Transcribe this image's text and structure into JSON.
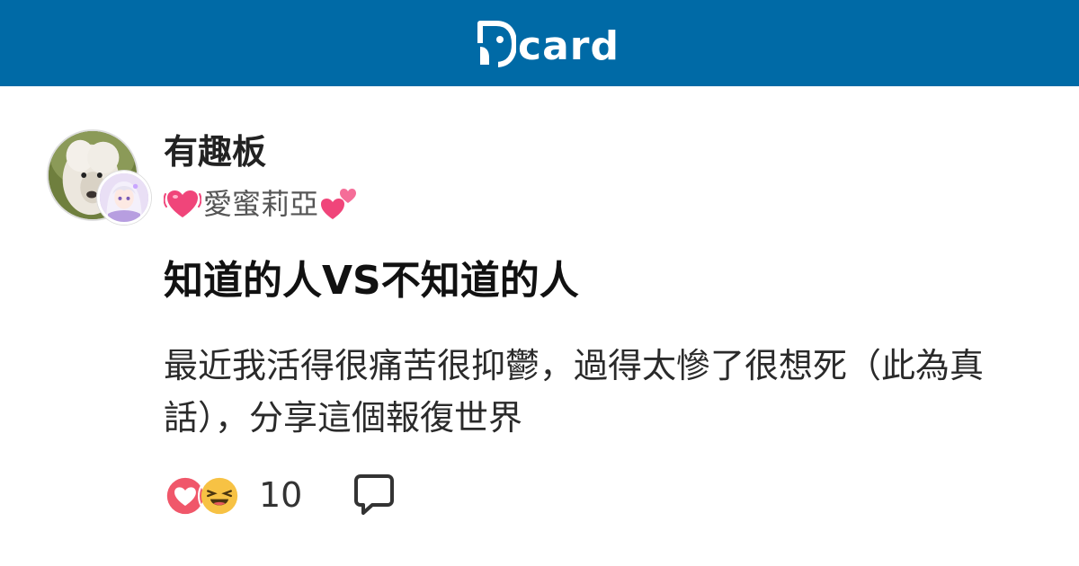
{
  "header": {
    "logo_text": "card",
    "logo_icon": "dcard-logo-icon",
    "background_color": "#006aa6"
  },
  "post": {
    "board_name": "有趣板",
    "author": {
      "prefix_emoji": "beating-heart-icon",
      "name": "愛蜜莉亞",
      "suffix_emoji": "two-hearts-icon"
    },
    "title": "知道的人VS不知道的人",
    "excerpt": "最近我活得很痛苦很抑鬱，過得太慘了很想死（此為真話），分享這個報復世界",
    "reactions": {
      "icons": [
        "heart-reaction-icon",
        "haha-reaction-icon"
      ],
      "count": "10"
    },
    "comment_icon": "comment-icon"
  }
}
